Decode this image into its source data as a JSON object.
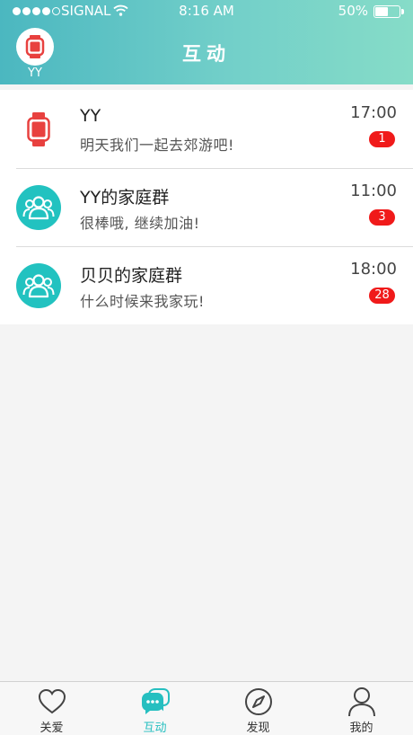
{
  "status_bar": {
    "carrier": "SIGNAL",
    "time": "8:16 AM",
    "battery_percent": "50%",
    "battery_level": 0.5
  },
  "header": {
    "title": "互动",
    "avatar_label": "YY",
    "avatar_icon": "watch-icon"
  },
  "conversations": [
    {
      "name": "YY",
      "message": "明天我们一起去郊游吧!",
      "time": "17:00",
      "unread": "1",
      "icon": "watch-icon"
    },
    {
      "name": "YY的家庭群",
      "message": "很棒哦, 继续加油!",
      "time": "11:00",
      "unread": "3",
      "icon": "group-icon"
    },
    {
      "name": "贝贝的家庭群",
      "message": "什么时候来我家玩!",
      "time": "18:00",
      "unread": "28",
      "icon": "group-icon"
    }
  ],
  "tabs": [
    {
      "label": "关爱",
      "icon": "heart-icon",
      "active": false
    },
    {
      "label": "互动",
      "icon": "chat-bubble-icon",
      "active": true
    },
    {
      "label": "发现",
      "icon": "compass-icon",
      "active": false
    },
    {
      "label": "我的",
      "icon": "person-icon",
      "active": false
    }
  ],
  "colors": {
    "accent": "#26bfc0",
    "badge": "#f01a1a",
    "watch": "#e8413f"
  }
}
